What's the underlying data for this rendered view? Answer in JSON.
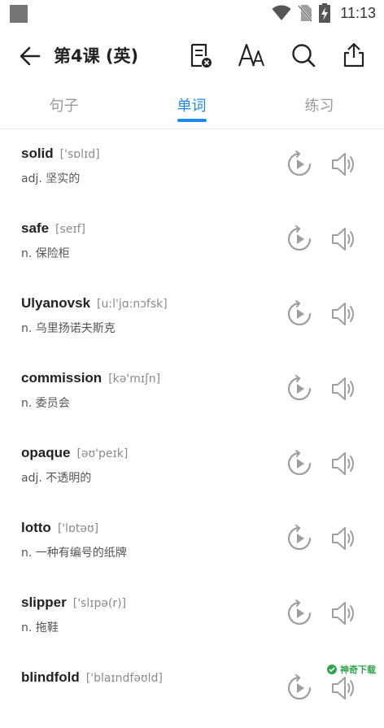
{
  "status_bar": {
    "time": "11:13"
  },
  "app_bar": {
    "title": "第4课 (英)"
  },
  "icons": {
    "back": "arrow-left-icon",
    "notes": "note-clear-icon",
    "font": "font-size-icon",
    "search": "search-icon",
    "share": "share-icon",
    "replay": "replay-icon",
    "speaker": "speaker-icon"
  },
  "tabs": [
    {
      "label": "句子",
      "active": false
    },
    {
      "label": "单词",
      "active": true
    },
    {
      "label": "练习",
      "active": false
    }
  ],
  "words": [
    {
      "word": "solid",
      "phonetic": "['sɒlɪd]",
      "meaning": "adj. 坚实的"
    },
    {
      "word": "safe",
      "phonetic": "[seɪf]",
      "meaning": "n. 保险柜"
    },
    {
      "word": "Ulyanovsk",
      "phonetic": "[u:l'jɑ:nɔfsk]",
      "meaning": "n. 乌里扬诺夫斯克"
    },
    {
      "word": "commission",
      "phonetic": "[kə'mɪʃn]",
      "meaning": "n. 委员会"
    },
    {
      "word": "opaque",
      "phonetic": "[əʊ'peɪk]",
      "meaning": "adj. 不透明的"
    },
    {
      "word": "lotto",
      "phonetic": "['lɒtəʊ]",
      "meaning": "n. 一种有编号的纸牌"
    },
    {
      "word": "slipper",
      "phonetic": "['slɪpə(r)]",
      "meaning": "n. 拖鞋"
    },
    {
      "word": "blindfold",
      "phonetic": "['blaɪndfəʊld]",
      "meaning": ""
    }
  ],
  "watermark": {
    "text": "神奇下载"
  },
  "colors": {
    "accent": "#1e8ae8",
    "icon_gray": "#9e9e9e",
    "dark": "#222222"
  }
}
